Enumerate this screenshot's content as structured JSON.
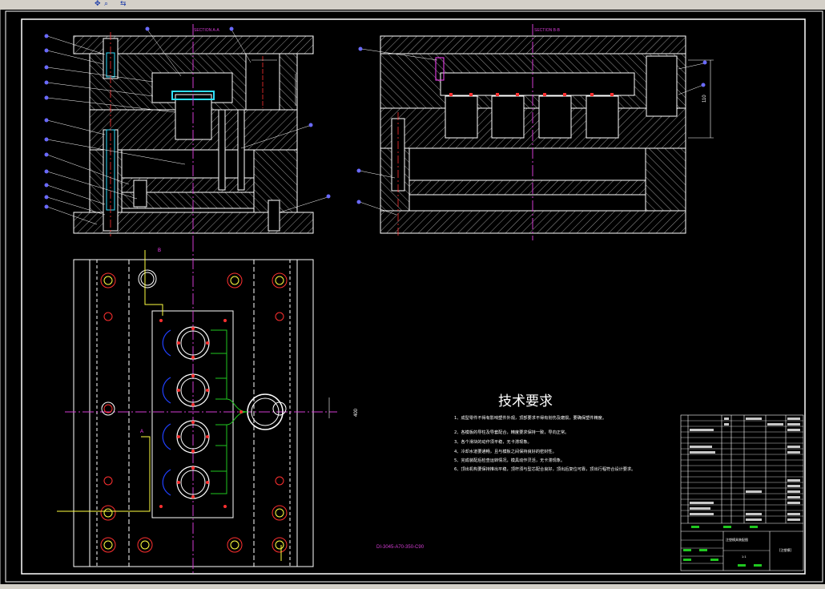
{
  "toolbar": {
    "icon_a": "pan-icon",
    "icon_b": "zoom-icon"
  },
  "drawing": {
    "section_a_label": "SECTION A-A",
    "section_b_label": "SECTION B-B",
    "dim_vertical_right": "110",
    "dim_plan_height": "400",
    "marker_b": "B",
    "marker_a": "A"
  },
  "tech": {
    "heading": "技术要求",
    "items": [
      "1、成型零件不得有影响塑件外观，顶部要求不得有划伤及磨损，要确保塑件精度。",
      "2、各模板的导柱及导套配合，精度要求保持一致，导向正常。",
      "3、各个滑块的动作须平稳，无卡滞现象。",
      "4、冷却水道要通畅，且与模板之间保持良好的密封性。",
      "5、完成装配后检查运转情况，模具动作灵活，无卡滞现象。",
      "6、顶出机构要保持推出平稳，顶杆须与型芯配合良好，顶出后复位可靠，顶出行程符合设计要求。"
    ]
  },
  "mold_spec": "DI-3045-A70-350-C90",
  "title_block": {
    "drawing_name": "注塑模具装配图",
    "scale": "1:1",
    "company": "[注塑模]"
  },
  "colors": {
    "line": "#ffffff",
    "center": "#d23cd2",
    "hatch": "#c8c8c8",
    "dim": "#ffffff",
    "balloon": "#6a6aff",
    "red": "#ff3030",
    "yellow": "#ffff40",
    "green": "#20c820",
    "cyan": "#30e0ff",
    "blue": "#2040ff"
  }
}
